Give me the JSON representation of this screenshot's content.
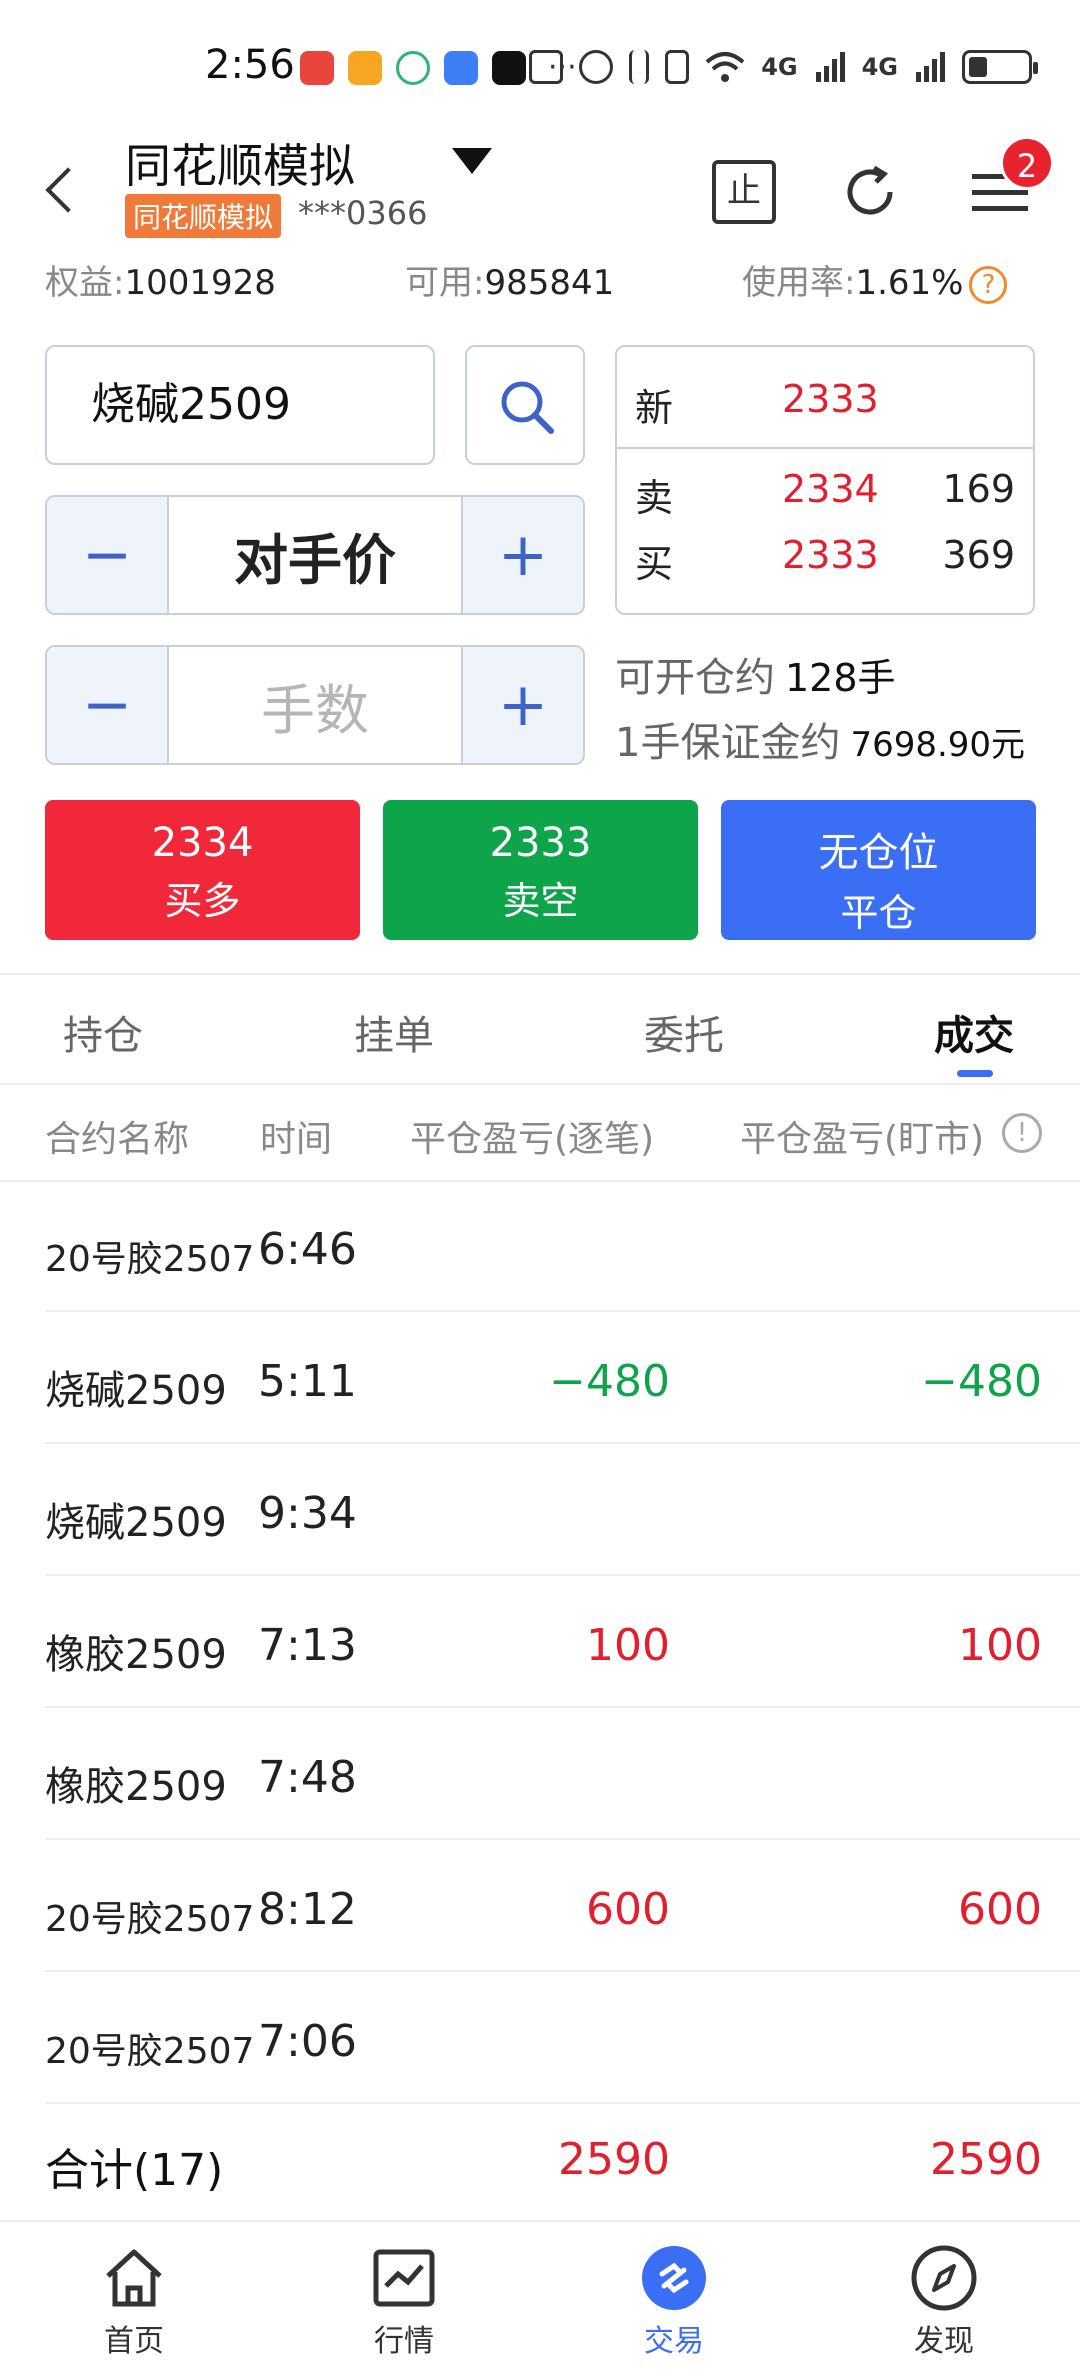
{
  "status_bar": {
    "time": "2:56",
    "overflow": "···",
    "network_1": "4G",
    "network_2": "4G"
  },
  "header": {
    "title": "同花顺模拟",
    "tag": "同花顺模拟",
    "account": "***0366",
    "stop_label": "止",
    "badge_count": "2"
  },
  "account_summary": {
    "equity_label": "权益:",
    "equity_value": "1001928",
    "available_label": "可用:",
    "available_value": "985841",
    "usage_label": "使用率:",
    "usage_value": "1.61%",
    "help": "?"
  },
  "order_form": {
    "symbol": "烧碱2509",
    "price_type": "对手价",
    "quantity_placeholder": "手数",
    "minus": "−",
    "plus": "+"
  },
  "quote": {
    "last_label": "新",
    "last_price": "2333",
    "ask_label": "卖",
    "ask_price": "2334",
    "ask_volume": "169",
    "bid_label": "买",
    "bid_price": "2333",
    "bid_volume": "369"
  },
  "info": {
    "openable_label": "可开仓约",
    "openable_value": "128手",
    "margin_label": "1手保证金约",
    "margin_value": "7698.90元"
  },
  "trade_buttons": {
    "buy_price": "2334",
    "buy_label": "买多",
    "sell_price": "2333",
    "sell_label": "卖空",
    "close_top": "无仓位",
    "close_label": "平仓"
  },
  "tabs": [
    "持仓",
    "挂单",
    "委托",
    "成交"
  ],
  "table": {
    "headers": {
      "name": "合约名称",
      "time": "时间",
      "pnl_trade": "平仓盈亏(逐笔)",
      "pnl_mark": "平仓盈亏(盯市)",
      "info": "!"
    },
    "rows": [
      {
        "name": "20号胶2507",
        "time": "6:46",
        "pnl_trade": "",
        "pnl_mark": ""
      },
      {
        "name": "烧碱2509",
        "time": "5:11",
        "pnl_trade": "−480",
        "pnl_mark": "−480"
      },
      {
        "name": "烧碱2509",
        "time": "9:34",
        "pnl_trade": "",
        "pnl_mark": ""
      },
      {
        "name": "橡胶2509",
        "time": "7:13",
        "pnl_trade": "100",
        "pnl_mark": "100"
      },
      {
        "name": "橡胶2509",
        "time": "7:48",
        "pnl_trade": "",
        "pnl_mark": ""
      },
      {
        "name": "20号胶2507",
        "time": "8:12",
        "pnl_trade": "600",
        "pnl_mark": "600"
      },
      {
        "name": "20号胶2507",
        "time": "7:06",
        "pnl_trade": "",
        "pnl_mark": ""
      }
    ],
    "total_label": "合计(17)",
    "total_pnl_trade": "2590",
    "total_pnl_mark": "2590"
  },
  "bottom_nav": [
    {
      "label": "首页",
      "icon": "home-icon"
    },
    {
      "label": "行情",
      "icon": "chart-icon"
    },
    {
      "label": "交易",
      "icon": "trade-icon"
    },
    {
      "label": "发现",
      "icon": "compass-icon"
    }
  ],
  "colors": {
    "up": "#e0202f",
    "down": "#0ea44a",
    "accent": "#3a6ef5",
    "tag": "#f07a3a"
  }
}
